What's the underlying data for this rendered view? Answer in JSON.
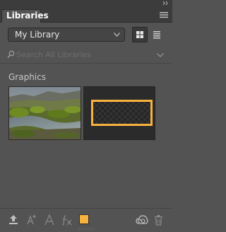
{
  "panel": {
    "tab_label": "Libraries"
  },
  "library": {
    "selected": "My Library",
    "options": [
      "My Library"
    ]
  },
  "view": {
    "mode": "grid"
  },
  "search": {
    "placeholder": "Search All Libraries"
  },
  "section": {
    "title": "Graphics",
    "items": [
      {
        "type": "graphic",
        "icon": "river-landscape-photo"
      },
      {
        "type": "graphic",
        "icon": "orange-rectangle-outline"
      }
    ]
  },
  "footer": {
    "icons": [
      "upload-icon",
      "add-character-style-icon",
      "add-text-icon",
      "add-layer-style-icon",
      "add-color-swatch",
      "creative-cloud-icon",
      "trash-icon"
    ],
    "swatch_color": "#F7B33F"
  },
  "colors": {
    "panel_bg": "#535353",
    "accent_orange": "#F7B33F"
  }
}
